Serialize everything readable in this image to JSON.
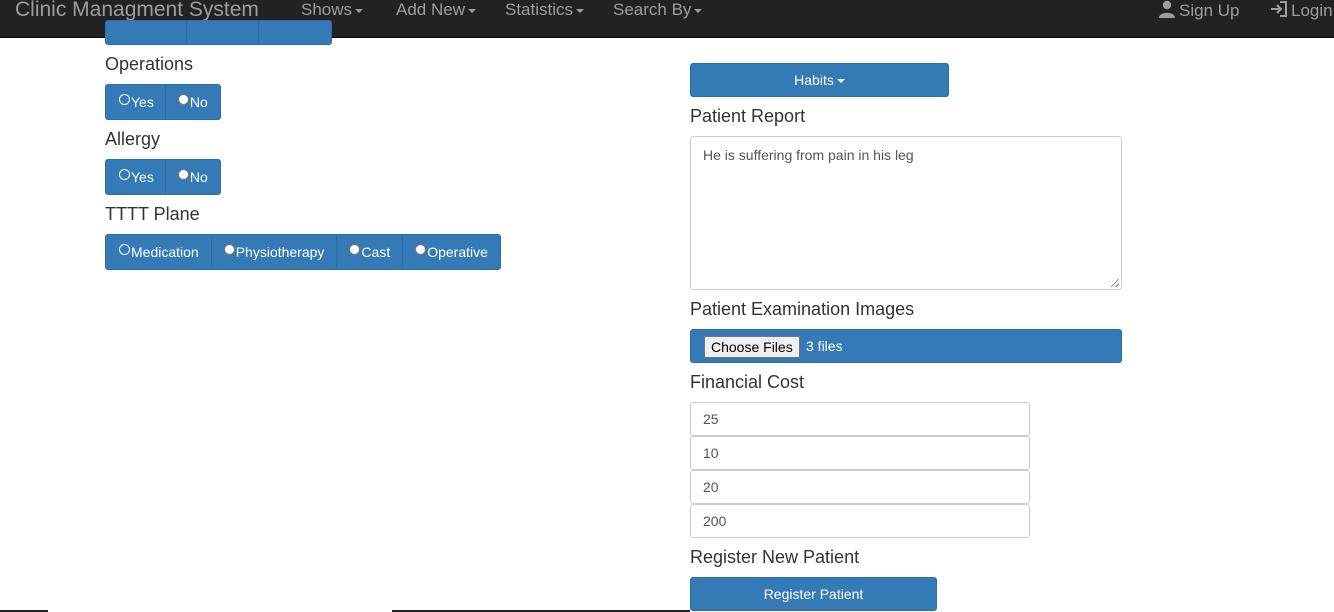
{
  "navbar": {
    "brand": "Clinic Managment System",
    "menus": [
      "Shows",
      "Add New",
      "Statistics",
      "Search By"
    ],
    "sign_up": "Sign Up",
    "login": "Login"
  },
  "left": {
    "operations": {
      "label": "Operations",
      "options": [
        "Yes",
        "No"
      ]
    },
    "allergy": {
      "label": "Allergy",
      "options": [
        "Yes",
        "No"
      ]
    },
    "tttt_plane": {
      "label": "TTTT Plane",
      "options": [
        "Medication",
        "Physiotherapy",
        "Cast",
        "Operative"
      ]
    }
  },
  "right": {
    "habits_button": "Habits",
    "patient_report": {
      "label": "Patient Report",
      "value": "He is suffering from pain in his leg"
    },
    "exam_images": {
      "label": "Patient Examination Images",
      "choose_button": "Choose Files",
      "status": "3 files"
    },
    "financial_cost": {
      "label": "Financial Cost",
      "values": [
        "25",
        "10",
        "20",
        "200"
      ]
    },
    "register": {
      "label": "Register New Patient",
      "button": "Register Patient"
    }
  },
  "colors": {
    "primary": "#337ab7",
    "navbar": "#222222",
    "nav_text": "#9d9d9d"
  }
}
